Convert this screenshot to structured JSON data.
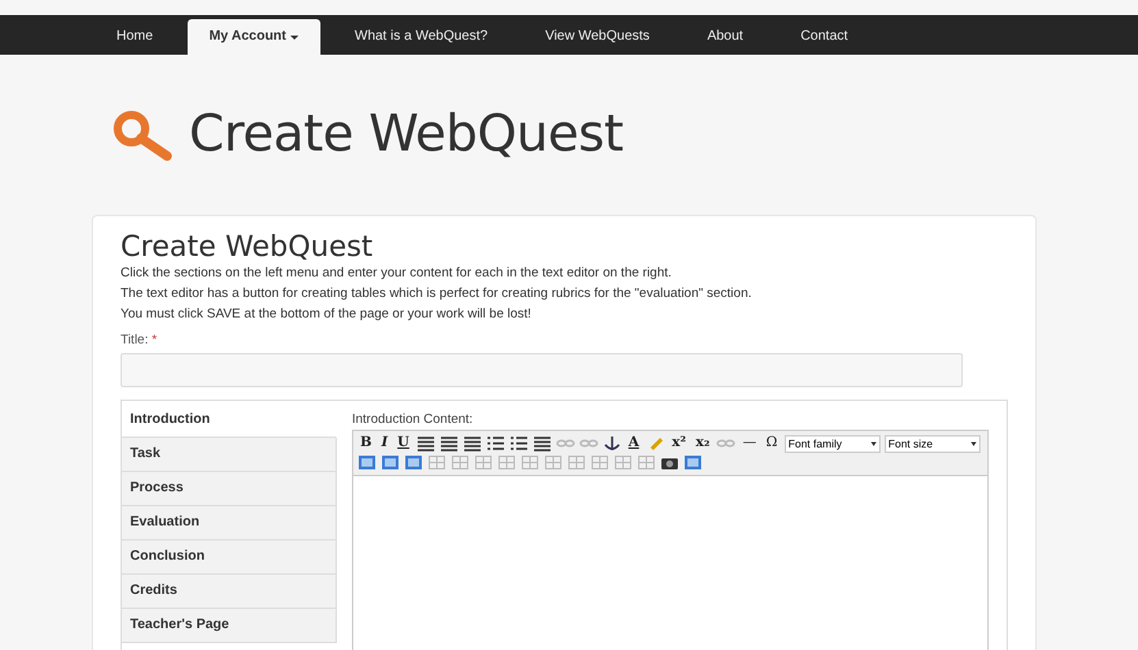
{
  "nav": {
    "items": [
      {
        "label": "Home",
        "selected": false,
        "dropdown": false
      },
      {
        "label": "My Account",
        "selected": true,
        "dropdown": true
      },
      {
        "label": "What is a WebQuest?",
        "selected": false,
        "dropdown": false
      },
      {
        "label": "View WebQuests",
        "selected": false,
        "dropdown": false
      },
      {
        "label": "About",
        "selected": false,
        "dropdown": false
      },
      {
        "label": "Contact",
        "selected": false,
        "dropdown": false
      }
    ]
  },
  "header": {
    "title": "Create WebQuest"
  },
  "card": {
    "heading": "Create WebQuest",
    "lines": [
      "Click the sections on the left menu and enter your content for each in the text editor on the right.",
      "The text editor has a button for creating tables which is perfect for creating rubrics for the \"evaluation\" section.",
      "You must click SAVE at the bottom of the page or your work will be lost!"
    ],
    "title_label": "Title:",
    "required_mark": "*"
  },
  "sections": [
    {
      "label": "Introduction",
      "selected": true
    },
    {
      "label": "Task",
      "selected": false
    },
    {
      "label": "Process",
      "selected": false
    },
    {
      "label": "Evaluation",
      "selected": false
    },
    {
      "label": "Conclusion",
      "selected": false
    },
    {
      "label": "Credits",
      "selected": false
    },
    {
      "label": "Teacher's Page",
      "selected": false
    }
  ],
  "editor": {
    "label": "Introduction Content:",
    "toolbar": [
      {
        "kind": "text",
        "label": "B"
      },
      {
        "kind": "text",
        "label": "I"
      },
      {
        "kind": "text",
        "label": "U"
      },
      {
        "kind": "icon"
      },
      {
        "kind": "icon"
      },
      {
        "kind": "icon"
      },
      {
        "kind": "icon"
      },
      {
        "kind": "icon"
      },
      {
        "kind": "icon"
      },
      {
        "kind": "icon"
      },
      {
        "kind": "icon"
      },
      {
        "kind": "icon"
      },
      {
        "kind": "text",
        "label": "A"
      },
      {
        "kind": "icon"
      },
      {
        "kind": "text",
        "label": "x²"
      },
      {
        "kind": "text",
        "label": "x₂"
      },
      {
        "kind": "icon"
      },
      {
        "kind": "text",
        "label": "—"
      },
      {
        "kind": "text",
        "label": "Ω"
      },
      {
        "kind": "select",
        "label": "Font family"
      },
      {
        "kind": "select",
        "label": "Font size"
      }
    ]
  }
}
